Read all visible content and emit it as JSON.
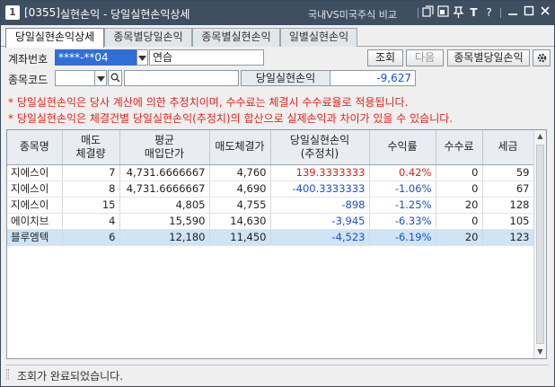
{
  "window": {
    "screen_no": "1",
    "screen_code": "[0355]",
    "title": "실현손익 - 당일실현손익상세",
    "link": "국내VS미국주식 비교",
    "icons": [
      "copy-icon",
      "restore-icon",
      "pin-icon",
      "font-icon",
      "help-icon",
      "minimize-icon",
      "maximize-icon",
      "close-icon"
    ],
    "colors": {
      "titlebar": "#3e4f61",
      "up": "#d8231b",
      "down": "#1a4fd0",
      "notice": "#e0261b",
      "selected_row": "#cfe4f5"
    }
  },
  "tabs": [
    {
      "label": "당일실현손익상세",
      "active": true
    },
    {
      "label": "종목별당일손익",
      "active": false
    },
    {
      "label": "종목별실현손익",
      "active": false
    },
    {
      "label": "일별실현손익",
      "active": false
    }
  ],
  "account": {
    "label": "계좌번호",
    "number": "****-**04",
    "name": "연습"
  },
  "buttons": {
    "query": "조회",
    "next": "다음",
    "by_stock": "종목별당일손익"
  },
  "stock": {
    "label": "종목코드",
    "code": "",
    "name": ""
  },
  "summary": {
    "label": "당일실현손익",
    "value": "-9,627"
  },
  "notes": [
    "* 당일실현손익은 당사 계산에 의한 추정치이며, 수수료는 체결시 수수료율로 적용됩니다.",
    "* 당일실현손익은 체결건별 당일실현손익(추정치)의 합산으로 실제손익과 차이가 있을 수 있습니다."
  ],
  "grid": {
    "columns": [
      {
        "l1": "종목명",
        "l2": ""
      },
      {
        "l1": "매도",
        "l2": "체결량"
      },
      {
        "l1": "평균",
        "l2": "매입단가"
      },
      {
        "l1": "매도체결가",
        "l2": ""
      },
      {
        "l1": "당일실현손익",
        "l2": "(추정치)"
      },
      {
        "l1": "수익률",
        "l2": ""
      },
      {
        "l1": "수수료",
        "l2": ""
      },
      {
        "l1": "세금",
        "l2": ""
      }
    ],
    "rows": [
      {
        "name": "지에스이",
        "qty": "7",
        "avg": "4,731.6666667",
        "price": "4,760",
        "pnl": "139.3333333",
        "rate": "0.42%",
        "fee": "0",
        "tax": "59",
        "dir": "up",
        "selected": false
      },
      {
        "name": "지에스이",
        "qty": "8",
        "avg": "4,731.6666667",
        "price": "4,690",
        "pnl": "-400.3333333",
        "rate": "-1.06%",
        "fee": "0",
        "tax": "67",
        "dir": "down",
        "selected": false
      },
      {
        "name": "지에스이",
        "qty": "15",
        "avg": "4,805",
        "price": "4,755",
        "pnl": "-898",
        "rate": "-1.25%",
        "fee": "20",
        "tax": "128",
        "dir": "down",
        "selected": false
      },
      {
        "name": "에이치브",
        "qty": "4",
        "avg": "15,590",
        "price": "14,630",
        "pnl": "-3,945",
        "rate": "-6.33%",
        "fee": "0",
        "tax": "105",
        "dir": "down",
        "selected": false
      },
      {
        "name": "블루엠텍",
        "qty": "6",
        "avg": "12,180",
        "price": "11,450",
        "pnl": "-4,523",
        "rate": "-6.19%",
        "fee": "20",
        "tax": "123",
        "dir": "down",
        "selected": true
      }
    ]
  },
  "status": {
    "message": "조회가 완료되었습니다."
  }
}
